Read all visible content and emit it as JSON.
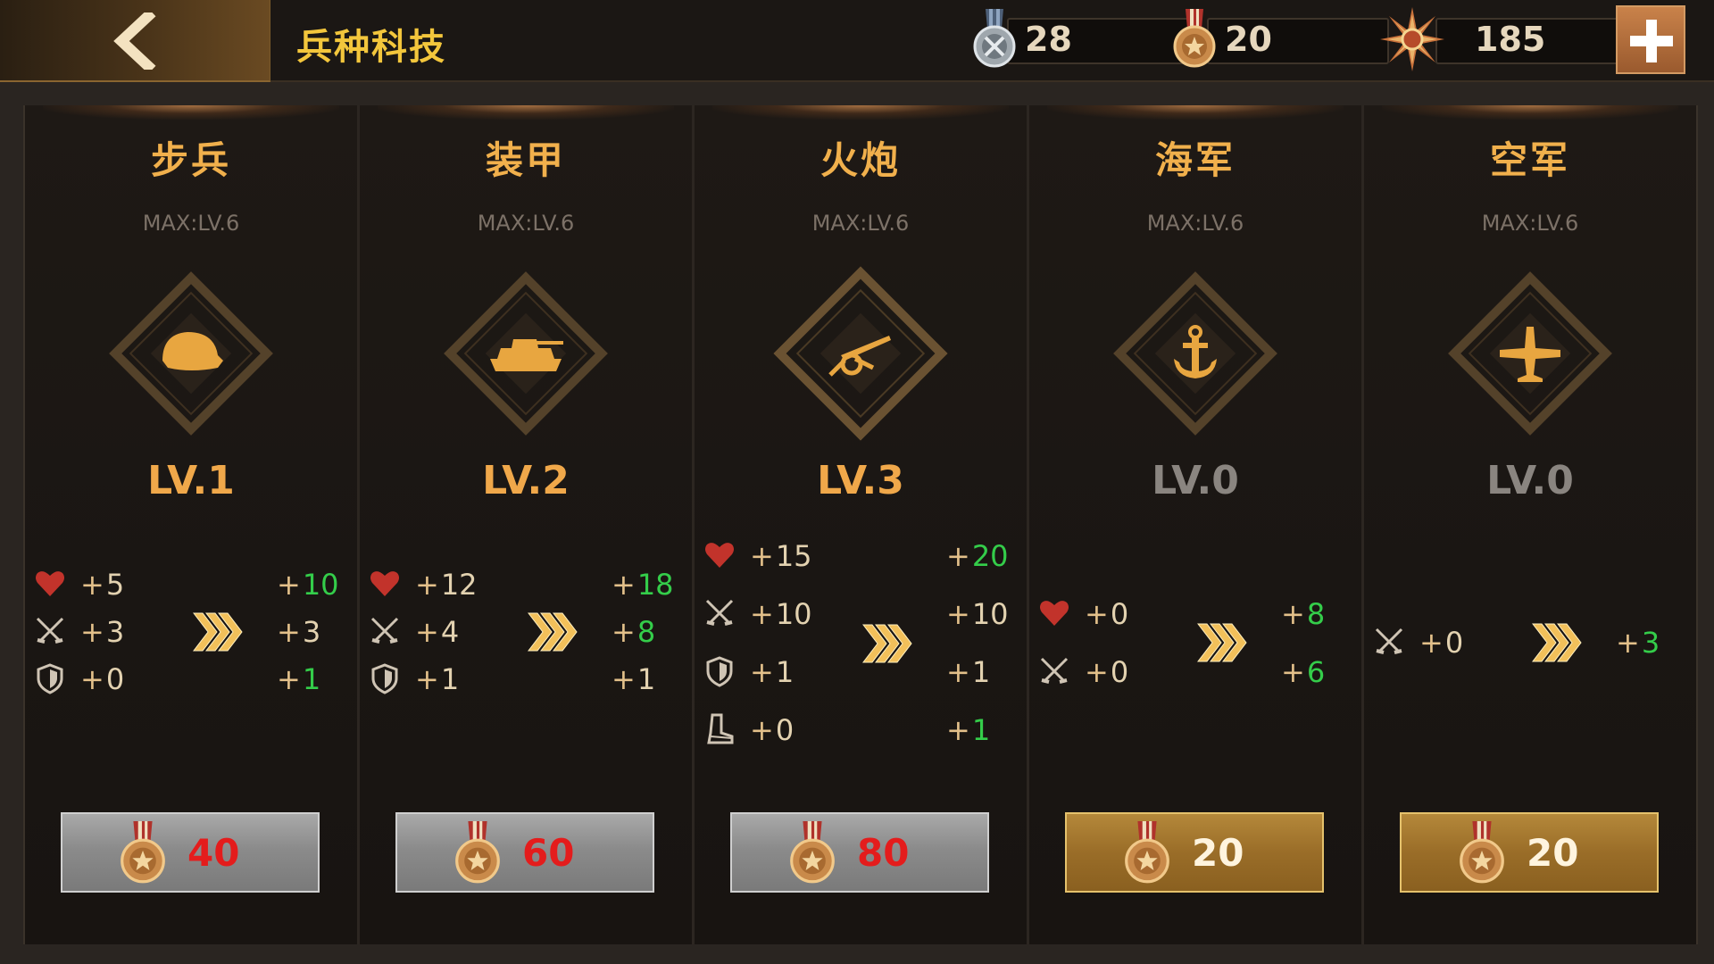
{
  "header": {
    "title": "兵种科技",
    "resources": [
      {
        "icon": "silver-medal-icon",
        "value": "28"
      },
      {
        "icon": "bronze-medal-icon",
        "value": "20"
      },
      {
        "icon": "star-badge-icon",
        "value": "185"
      }
    ]
  },
  "colors": {
    "accent": "#f1b04c",
    "gain": "#34cd4a",
    "insufficient": "#e41c1c"
  },
  "panels": [
    {
      "key": "infantry",
      "name": "步兵",
      "max": "MAX:LV.6",
      "level": "LV.1",
      "active": true,
      "stats": [
        {
          "type": "hp",
          "cur": "5",
          "next": "10",
          "up": true
        },
        {
          "type": "attack",
          "cur": "3",
          "next": "3",
          "up": false
        },
        {
          "type": "defense",
          "cur": "0",
          "next": "1",
          "up": true
        }
      ],
      "cost": "40",
      "affordable": false
    },
    {
      "key": "armor",
      "name": "装甲",
      "max": "MAX:LV.6",
      "level": "LV.2",
      "active": true,
      "stats": [
        {
          "type": "hp",
          "cur": "12",
          "next": "18",
          "up": true
        },
        {
          "type": "attack",
          "cur": "4",
          "next": "8",
          "up": true
        },
        {
          "type": "defense",
          "cur": "1",
          "next": "1",
          "up": false
        }
      ],
      "cost": "60",
      "affordable": false
    },
    {
      "key": "artillery",
      "name": "火炮",
      "max": "MAX:LV.6",
      "level": "LV.3",
      "active": true,
      "stats": [
        {
          "type": "hp",
          "cur": "15",
          "next": "20",
          "up": true
        },
        {
          "type": "attack",
          "cur": "10",
          "next": "10",
          "up": false
        },
        {
          "type": "defense",
          "cur": "1",
          "next": "1",
          "up": false
        },
        {
          "type": "speed",
          "cur": "0",
          "next": "1",
          "up": true
        }
      ],
      "cost": "80",
      "affordable": false
    },
    {
      "key": "navy",
      "name": "海军",
      "max": "MAX:LV.6",
      "level": "LV.0",
      "active": false,
      "stats": [
        {
          "type": "hp",
          "cur": "0",
          "next": "8",
          "up": true
        },
        {
          "type": "attack",
          "cur": "0",
          "next": "6",
          "up": true
        }
      ],
      "cost": "20",
      "affordable": true
    },
    {
      "key": "airforce",
      "name": "空军",
      "max": "MAX:LV.6",
      "level": "LV.0",
      "active": false,
      "stats": [
        {
          "type": "attack",
          "cur": "0",
          "next": "3",
          "up": true
        }
      ],
      "cost": "20",
      "affordable": true
    }
  ]
}
